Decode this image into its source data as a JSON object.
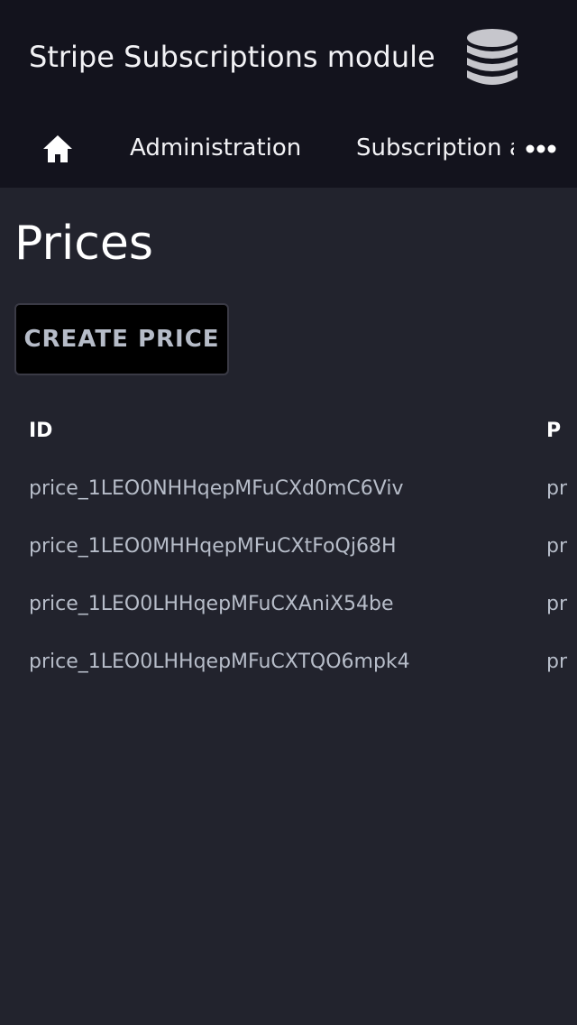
{
  "header": {
    "title": "Stripe Subscriptions module",
    "logo_icon": "database-icon"
  },
  "nav": {
    "home_icon": "home-icon",
    "items": [
      {
        "label": "Administration"
      },
      {
        "label": "Subscription a"
      }
    ],
    "more_icon": "more-horizontal-icon"
  },
  "page": {
    "title": "Prices",
    "create_button": "CREATE PRICE"
  },
  "table": {
    "columns": [
      "ID",
      "P"
    ],
    "rows": [
      {
        "id": "price_1LEO0NHHqepMFuCXd0mC6Viv",
        "p": "pr"
      },
      {
        "id": "price_1LEO0MHHqepMFuCXtFoQj68H",
        "p": "pr"
      },
      {
        "id": "price_1LEO0LHHqepMFuCXAniX54be",
        "p": "pr"
      },
      {
        "id": "price_1LEO0LHHqepMFuCXTQO6mpk4",
        "p": "pr"
      }
    ]
  },
  "colors": {
    "header_bg": "#13131d",
    "page_bg": "#22232d",
    "muted_text": "#b7bdc9"
  }
}
